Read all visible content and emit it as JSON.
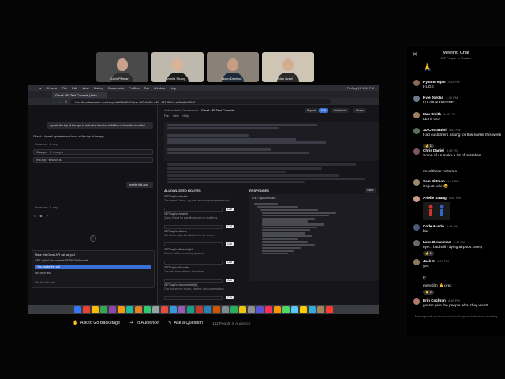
{
  "tiles": [
    {
      "name": "Zach Pittman",
      "wall": "#4a4a4a",
      "skin": "#c8a28a",
      "shirt": "#2c2c2c"
    },
    {
      "name": "Amelia Strang",
      "wall": "#bfb8ac",
      "skin": "#d9b49a",
      "shirt": "#1a1a1a"
    },
    {
      "name": "Jason Denison",
      "wall": "#8a8276",
      "skin": "#c69c82",
      "shirt": "#1e2a3a"
    },
    {
      "name": "Dylan Israel",
      "wall": "#cfc5b5",
      "skin": "#d3ad92",
      "shirt": "#2a2a2a"
    }
  ],
  "screen": {
    "menubar": {
      "items": [
        "Chrome",
        "File",
        "Edit",
        "View",
        "History",
        "Bookmarks",
        "Profiles",
        "Tab",
        "Window",
        "Help"
      ],
      "clock": "Fri Aug 16 1:34 PM"
    },
    "tab_title": "Gmail API Test Console (Anth...",
    "url": "test.thunderadmin.com/apps/e4f8b0f6d?chat=5f2b6e8b-a4f1-4ff1-8004-a66fe8a079d1",
    "chat": {
      "bubble1": "update the top of the app to include a function definition of how this is called",
      "reply1": "I'll add a #gmail-api-reference block at the top of the app.",
      "thought1": "Reasoned · 1 step",
      "changes_label": "Changes",
      "changes_count": "2 changes",
      "file_row": "edit.app · function.ts",
      "bubble2": "rewrite this app",
      "thought2": "Reasoned · 1 step",
      "prompt": "Make this Gmail API call as you!",
      "action": "GET /api/v1/documents/PDP6d7fe/favorite",
      "option_selected": "Yes, make the call",
      "option_no": "No, don't ask",
      "footer": "Use the full form"
    },
    "console": {
      "breadcrumb": "Automated's Documents",
      "title": "Gmail API Test Console",
      "menu": [
        "File",
        "View",
        "Help"
      ],
      "buttons": [
        "Explore",
        "Edit",
        "Workbook",
        "Share"
      ],
      "section_fns": "ALLOWLISTED ROUTES",
      "section_resp": "RESPONSES",
      "clear_label": "Clear",
      "call_label": "Call",
      "functions": [
        {
          "sig": "GET /api/v1/emails",
          "desc": "The viewer's inbox, org-role, and connected permissions."
        },
        {
          "sig": "GET /api/v1/search",
          "desc": "Query thread for specific domain on headlines."
        },
        {
          "sig": "GET /api/v1/labels",
          "desc": "Get labels and a list attributed to the viewer."
        },
        {
          "sig": "GET /api/v1/threads/{id}",
          "desc": "Search visible records by keyword."
        },
        {
          "sig": "GET /api/v1/favorite",
          "desc": "The data from visible to the viewer."
        },
        {
          "sig": "GET /api/v1/documents/{id}",
          "desc": "One document's record, preview, and conversations."
        }
      ],
      "resp_header": "GET /api/v1/emails"
    }
  },
  "bottombar": {
    "backstage": "Ask to Go Backstage",
    "audience": "To Audience",
    "question": "Ask a Question",
    "count": "142 People in Audience"
  },
  "chat": {
    "title": "Meeting Chat",
    "subtitle": "147 People in Theater",
    "messages": [
      {
        "who": "",
        "time": "",
        "text": "🙏",
        "avatar": ""
      },
      {
        "who": "Ryan Brogan",
        "time": "4:42 PM",
        "text": "HUGE",
        "avatar": "#8a6a55"
      },
      {
        "who": "Kyle Jordan",
        "time": "4:42 PM",
        "text": "LUUUUKKKEEEE",
        "avatar": "#6a7a8a"
      },
      {
        "who": "Max Smith",
        "time": "4:43 PM",
        "text": "LETS GO",
        "avatar": "#a08060"
      },
      {
        "who": "JD Costantini",
        "time": "4:43 PM",
        "text": "Had customers asking for this earlier this week",
        "avatar": "#5a6e5a"
      },
      {
        "who": "Chris Daniel",
        "time": "4:43 PM",
        "text": "Some of us make a lot of mistakes",
        "avatar": "#7a5a5a"
      },
      {
        "who": "",
        "time": "",
        "text": "need those histories",
        "avatar": ""
      },
      {
        "who": "Sam Pittman",
        "time": "4:44 PM",
        "text": "it's just luke 😂",
        "avatar": "#9a8a6a"
      },
      {
        "who": "Arielle Strang",
        "time": "4:44 PM",
        "text": "",
        "avatar": "#c89a8a"
      },
      {
        "who": "Code Austin",
        "time": "4:44 PM",
        "text": "bar",
        "avatar": "#4a5a7a"
      },
      {
        "who": "Luke Bowerman",
        "time": "4:44 PM",
        "text": "eye... bad will i dying airpods. Sorry",
        "avatar": "#6a6a6a"
      },
      {
        "who": "Jack K",
        "time": "4:47 PM",
        "text": "yes",
        "avatar": "#8a7a5a"
      },
      {
        "who": "",
        "time": "",
        "text": "ty",
        "avatar": ""
      },
      {
        "who": "",
        "time": "",
        "text": "meredith 👍 prez",
        "avatar": ""
      },
      {
        "who": "Erin Cochran",
        "time": "4:48 PM",
        "text": "yesss! give the people what they want!",
        "avatar": "#b07a6a"
      }
    ],
    "reactions": [
      "👍 1",
      "👍 1",
      "👏 2"
    ],
    "note": "Messages will not be saved, but will appear in the video recording"
  },
  "colors": {
    "accent": "#3b6fd8",
    "pill": "#e8e8e8",
    "status_green": "#34c759"
  }
}
